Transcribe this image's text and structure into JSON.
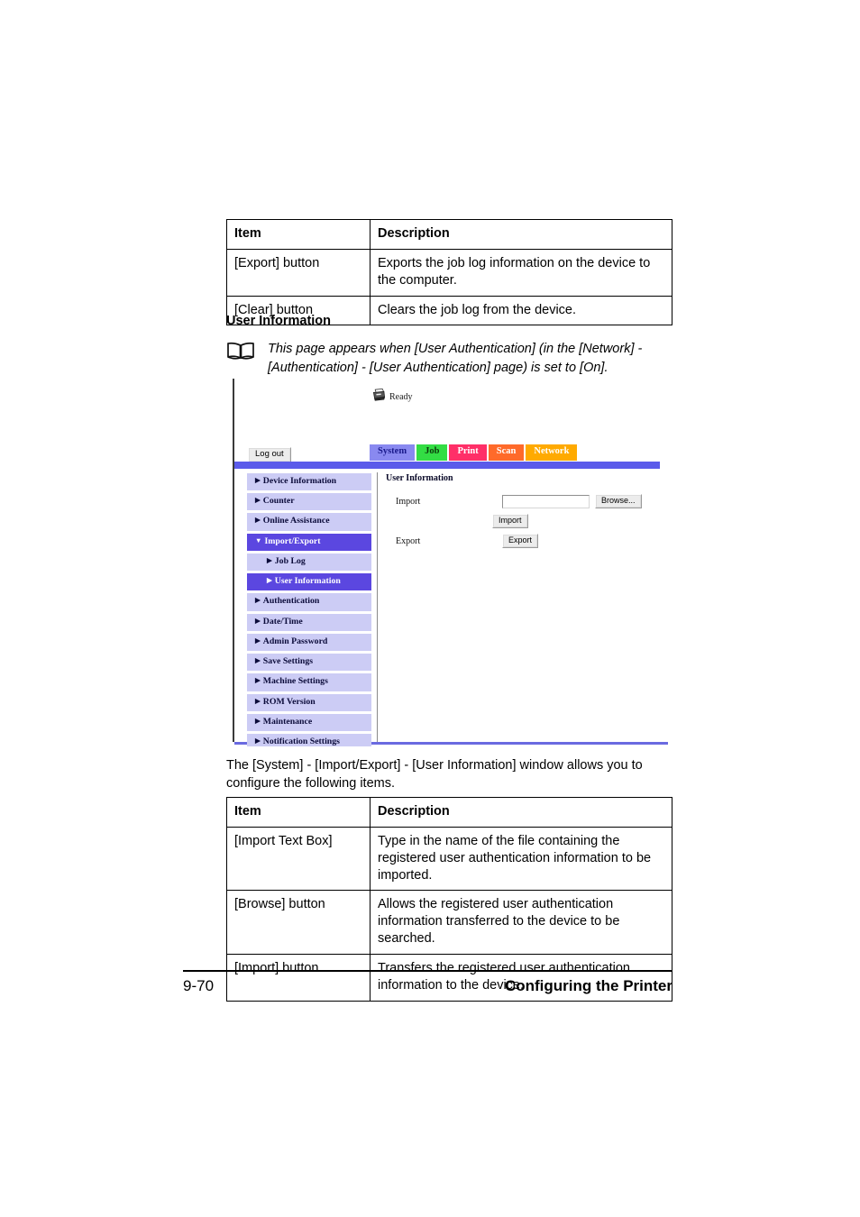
{
  "top_table": {
    "headers": [
      "Item",
      "Description"
    ],
    "rows": [
      [
        "[Export] button",
        "Exports the job log information on the device to the computer."
      ],
      [
        "[Clear] button",
        "Clears the job log from the device."
      ]
    ]
  },
  "section": {
    "heading": "User Information"
  },
  "note": {
    "icon": "open-book-icon",
    "text": "This page appears when [User Authentication] (in the [Network] - [Authentication] - [User Authentication] page) is set to [On]."
  },
  "screenshot": {
    "status": {
      "icon": "printer-icon",
      "label": "Ready"
    },
    "logout_label": "Log out",
    "tabs": [
      {
        "label": "System",
        "bg": "#8989f0",
        "fg": "#1a1a8c"
      },
      {
        "label": "Job",
        "bg": "#33dd44",
        "fg": "#0b3a0b"
      },
      {
        "label": "Print",
        "bg": "#ff2f68",
        "fg": "#ffffff"
      },
      {
        "label": "Scan",
        "bg": "#ff6a2a",
        "fg": "#ffffff"
      },
      {
        "label": "Network",
        "bg": "#ffaa00",
        "fg": "#ffffff"
      }
    ],
    "accent_bar_color": "#5b5bea",
    "sidebar": [
      {
        "label": "Device Information",
        "level": 0,
        "expanded": false,
        "active": false
      },
      {
        "label": "Counter",
        "level": 0,
        "expanded": false,
        "active": false
      },
      {
        "label": "Online Assistance",
        "level": 0,
        "expanded": false,
        "active": false
      },
      {
        "label": "Import/Export",
        "level": 0,
        "expanded": true,
        "active": true
      },
      {
        "label": "Job Log",
        "level": 1,
        "expanded": false,
        "active": false
      },
      {
        "label": "User Information",
        "level": 1,
        "expanded": false,
        "active": true
      },
      {
        "label": "Authentication",
        "level": 0,
        "expanded": false,
        "active": false
      },
      {
        "label": "Date/Time",
        "level": 0,
        "expanded": false,
        "active": false
      },
      {
        "label": "Admin Password",
        "level": 0,
        "expanded": false,
        "active": false
      },
      {
        "label": "Save Settings",
        "level": 0,
        "expanded": false,
        "active": false
      },
      {
        "label": "Machine Settings",
        "level": 0,
        "expanded": false,
        "active": false
      },
      {
        "label": "ROM Version",
        "level": 0,
        "expanded": false,
        "active": false
      },
      {
        "label": "Maintenance",
        "level": 0,
        "expanded": false,
        "active": false
      },
      {
        "label": "Notification Settings",
        "level": 0,
        "expanded": false,
        "active": false
      }
    ],
    "content": {
      "title": "User Information",
      "import_label": "Import",
      "import_value": "",
      "import_placeholder": "",
      "browse_label": "Browse...",
      "import_button_label": "Import",
      "export_label": "Export",
      "export_button_label": "Export"
    }
  },
  "body_paragraph": "The [System] - [Import/Export] - [User Information] window allows you to configure the following items.",
  "bottom_table": {
    "headers": [
      "Item",
      "Description"
    ],
    "rows": [
      [
        "[Import Text Box]",
        "Type in the name of the file containing the registered user authentication information to be imported."
      ],
      [
        "[Browse] button",
        "Allows the registered user authentication information transferred to the device to be searched."
      ],
      [
        "[Import] button",
        "Transfers the registered user authentication information to the device."
      ]
    ]
  },
  "footer": {
    "page_number": "9-70",
    "chapter_title": "Configuring the Printer"
  }
}
